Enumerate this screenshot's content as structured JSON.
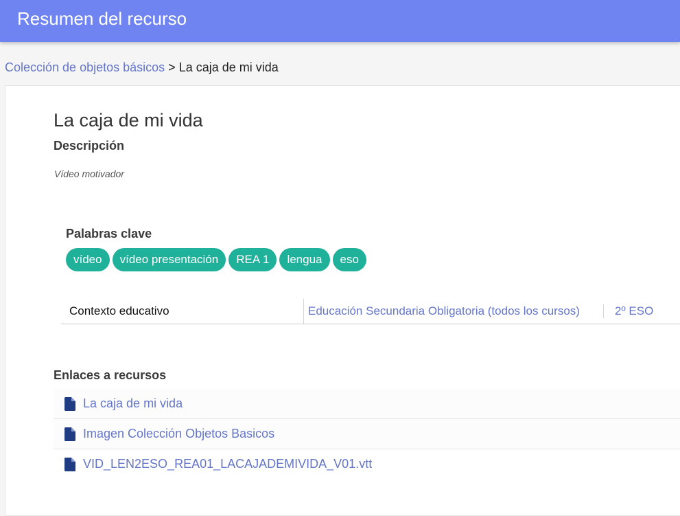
{
  "header": {
    "title": "Resumen del recurso"
  },
  "breadcrumb": {
    "parent": "Colección de objetos básicos",
    "separator": ">",
    "current": "La caja de mi vida"
  },
  "resource": {
    "title": "La caja de mi vida",
    "description_label": "Descripción",
    "description": "Vídeo motivador",
    "keywords_label": "Palabras clave",
    "keywords": [
      "vídeo",
      "vídeo presentación",
      "REA 1",
      "lengua",
      "eso"
    ],
    "context": {
      "label": "Contexto educativo",
      "level": "Educación Secundaria Obligatoria (todos los cursos)",
      "course": "2º ESO"
    },
    "links_label": "Enlaces a recursos",
    "links": [
      {
        "label": "La caja de mi vida",
        "icon": "file-icon"
      },
      {
        "label": "Imagen Colección Objetos Basicos",
        "icon": "file-icon"
      },
      {
        "label": "VID_LEN2ESO_REA01_LACAJADEMIVIDA_V01.vtt",
        "icon": "file-icon"
      }
    ]
  },
  "colors": {
    "header": "#6f84f1",
    "link": "#6576c9",
    "tag": "#1fb19a",
    "file_icon": "#1f3b82"
  }
}
